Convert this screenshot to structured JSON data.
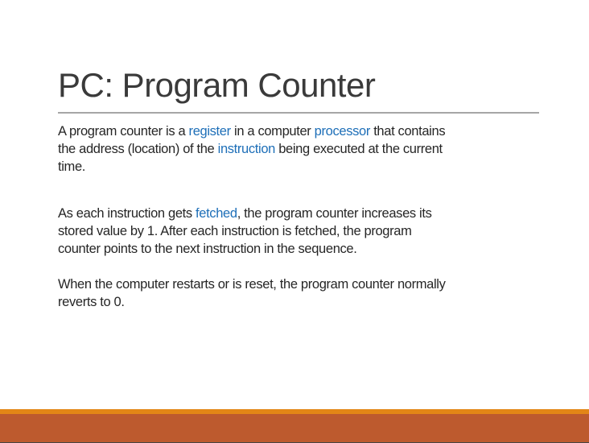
{
  "slide": {
    "title": "PC: Program Counter",
    "paragraphs": [
      [
        [
          {
            "t": "A program counter is a "
          },
          {
            "t": "register",
            "link": true
          },
          {
            "t": " in a computer "
          },
          {
            "t": "processor",
            "link": true
          },
          {
            "t": " that contains"
          }
        ],
        [
          {
            "t": "the address (location) of the "
          },
          {
            "t": "instruction",
            "link": true
          },
          {
            "t": " being executed at the current"
          }
        ],
        [
          {
            "t": "time."
          }
        ]
      ],
      [
        [
          {
            "t": "As each instruction gets "
          },
          {
            "t": "fetched",
            "link": true
          },
          {
            "t": ", the program counter increases its"
          }
        ],
        [
          {
            "t": "stored value by 1.  After each instruction is fetched, the program"
          }
        ],
        [
          {
            "t": "counter points to the next instruction in the sequence."
          }
        ]
      ],
      [
        [
          {
            "t": "When the computer restarts or is reset, the program counter normally"
          }
        ],
        [
          {
            "t": "reverts to 0."
          }
        ]
      ]
    ]
  },
  "colors": {
    "link": "#1e6fb8",
    "accent_stripe": "#e38616",
    "footer_band": "#bd5a2e"
  }
}
